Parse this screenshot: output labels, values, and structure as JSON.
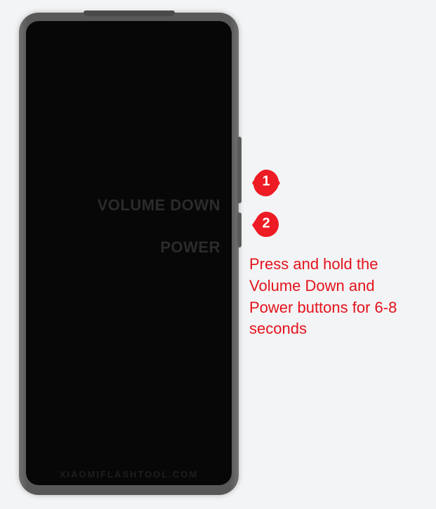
{
  "labels": {
    "volume_down": "VOLUME DOWN",
    "power": "POWER",
    "watermark": "XIAOMIFLASHTOOL.COM"
  },
  "callouts": {
    "one": "1",
    "two": "2"
  },
  "instruction": "Press and hold the Volume Down and Power buttons for 6-8 seconds"
}
